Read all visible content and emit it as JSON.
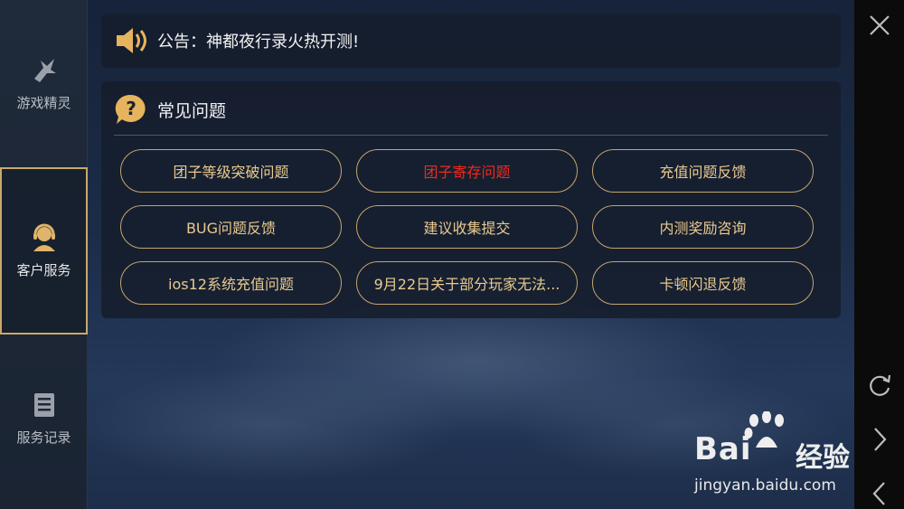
{
  "sidebar": {
    "items": [
      {
        "label": "游戏精灵",
        "icon": "sprite-icon",
        "active": false
      },
      {
        "label": "客户服务",
        "icon": "customer-service-icon",
        "active": true
      },
      {
        "label": "服务记录",
        "icon": "records-icon",
        "active": false
      }
    ]
  },
  "notice": {
    "icon": "speaker-icon",
    "text": "公告：神都夜行录火热开测!"
  },
  "faq": {
    "icon": "question-icon",
    "title": "常见问题",
    "questions": [
      {
        "label": "团子等级突破问题",
        "highlight": false
      },
      {
        "label": "团子寄存问题",
        "highlight": true
      },
      {
        "label": "充值问题反馈",
        "highlight": false
      },
      {
        "label": "BUG问题反馈",
        "highlight": false
      },
      {
        "label": "建议收集提交",
        "highlight": false
      },
      {
        "label": "内测奖励咨询",
        "highlight": false
      },
      {
        "label": "ios12系统充值问题",
        "highlight": false
      },
      {
        "label": "9月22日关于部分玩家无法...",
        "highlight": false
      },
      {
        "label": "卡顿闪退反馈",
        "highlight": false
      }
    ]
  },
  "rightbar": {
    "buttons": [
      "close-icon",
      "refresh-icon",
      "forward-icon",
      "back-icon"
    ]
  },
  "watermark": {
    "logo": "Bai",
    "logo_cn": "经验",
    "url": "jingyan.baidu.com"
  },
  "colors": {
    "accent_gold": "#c5a46e",
    "button_text": "#e9c98f",
    "highlight_red": "#ef2a1f",
    "panel_bg": "#161e2c"
  }
}
